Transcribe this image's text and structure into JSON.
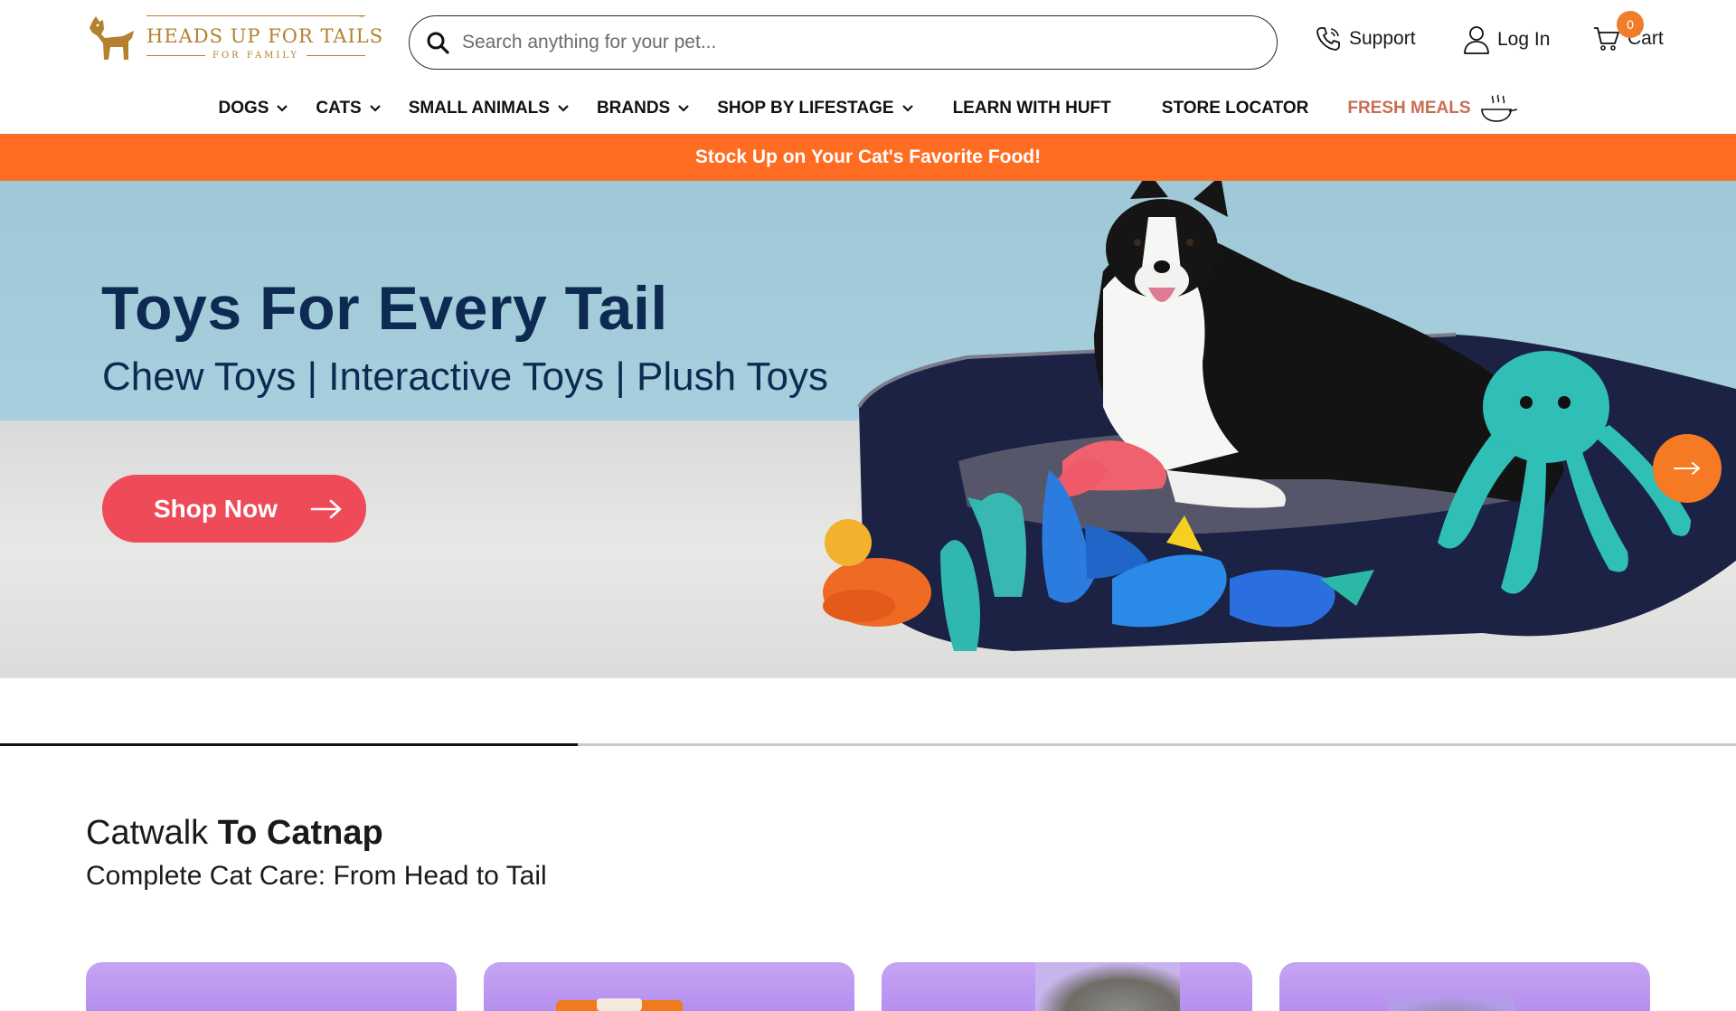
{
  "brand": {
    "name": "HEADS UP FOR TAILS",
    "tagline": "FOR FAMILY",
    "trademark": "™",
    "color": "#b3812f"
  },
  "search": {
    "placeholder": "Search anything for your pet..."
  },
  "header_links": {
    "support": "Support",
    "login": "Log In",
    "cart": "Cart",
    "cart_count": "0"
  },
  "nav": {
    "items": [
      {
        "label": "DOGS",
        "dropdown": true
      },
      {
        "label": "CATS",
        "dropdown": true
      },
      {
        "label": "SMALL ANIMALS",
        "dropdown": true
      },
      {
        "label": "BRANDS",
        "dropdown": true
      },
      {
        "label": "SHOP BY LIFESTAGE",
        "dropdown": true
      },
      {
        "label": "LEARN WITH HUFT",
        "dropdown": false
      },
      {
        "label": "STORE LOCATOR",
        "dropdown": false
      },
      {
        "label": "FRESH MEALS",
        "dropdown": false,
        "icon": "bowl-icon"
      }
    ]
  },
  "promo": {
    "text": "Stock Up on Your Cat's Favorite Food!",
    "color": "#ff6d23"
  },
  "hero": {
    "title": "Toys For Every Tail",
    "subtitle": "Chew Toys | Interactive Toys | Plush Toys",
    "cta": "Shop Now",
    "cta_color": "#ef4a58",
    "next_icon": "arrow-right-icon"
  },
  "carousel": {
    "progress": 0.333
  },
  "section": {
    "title_light": "Catwalk ",
    "title_bold": "To Catnap",
    "subtitle": "Complete Cat Care: From Head to Tail"
  },
  "colors": {
    "accent_orange": "#f57a23",
    "hero_text": "#0d2b52",
    "card_bg": "#b28df0"
  }
}
